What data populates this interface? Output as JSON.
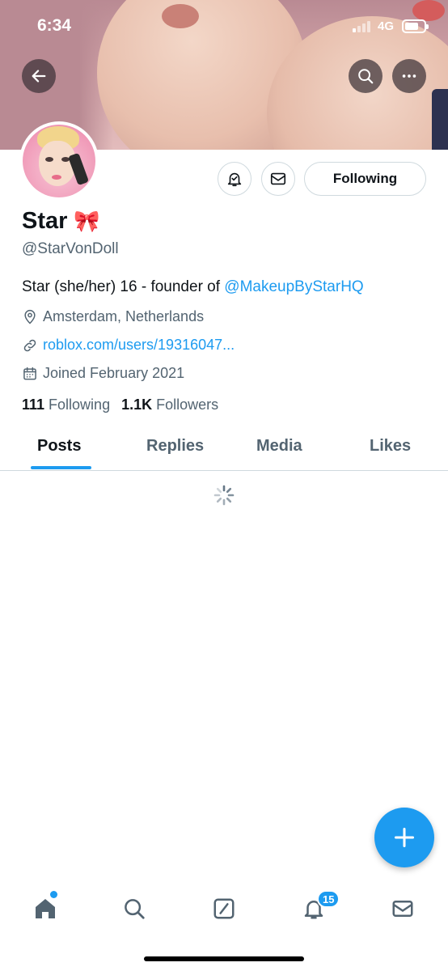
{
  "status_bar": {
    "time": "6:34",
    "network": "4G"
  },
  "header": {
    "back_icon": "back-arrow-icon",
    "search_icon": "search-icon",
    "more_icon": "more-horizontal-icon"
  },
  "profile": {
    "display_name": "Star",
    "name_emoji": "🎀",
    "handle": "@StarVonDoll",
    "bio_text": "Star (she/her) 16 - founder of ",
    "bio_mention": "@MakeupByStarHQ",
    "location": "Amsterdam, Netherlands",
    "website": "roblox.com/users/19316047...",
    "joined": "Joined February 2021",
    "following_count": "111",
    "following_label": "Following",
    "followers_count": "1.1K",
    "followers_label": "Followers"
  },
  "actions": {
    "notify_icon": "bell-check-icon",
    "message_icon": "envelope-icon",
    "following_button": "Following"
  },
  "tabs": [
    {
      "label": "Posts",
      "active": true
    },
    {
      "label": "Replies",
      "active": false
    },
    {
      "label": "Media",
      "active": false
    },
    {
      "label": "Likes",
      "active": false
    }
  ],
  "bottom_nav": {
    "items": [
      "home-icon",
      "search-icon",
      "compose-icon",
      "bell-icon",
      "envelope-icon"
    ],
    "notification_badge": "15"
  },
  "colors": {
    "accent": "#1d9bf0",
    "text": "#0f1419",
    "muted": "#536471",
    "border": "#cfd9de"
  }
}
